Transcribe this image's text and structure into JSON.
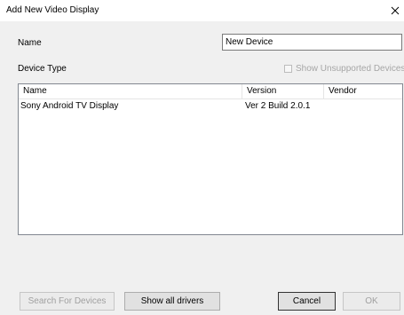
{
  "window": {
    "title": "Add New Video Display"
  },
  "form": {
    "name_label": "Name",
    "name_value": "New Device",
    "device_type_label": "Device Type",
    "show_unsupported_label": "Show Unsupported Devices",
    "show_unsupported_checked": false
  },
  "device_list": {
    "columns": [
      "Name",
      "Version",
      "Vendor"
    ],
    "rows": [
      {
        "name": "Sony Android TV Display",
        "version": "Ver 2 Build 2.0.1",
        "vendor": ""
      }
    ]
  },
  "buttons": {
    "search": "Search For Devices",
    "show_all": "Show all drivers",
    "cancel": "Cancel",
    "ok": "OK"
  },
  "colors": {
    "dialog_background": "#f0f0f0",
    "disabled_text": "#a0a0a0",
    "border": "#828790"
  },
  "icons": {
    "close": "close-icon"
  }
}
